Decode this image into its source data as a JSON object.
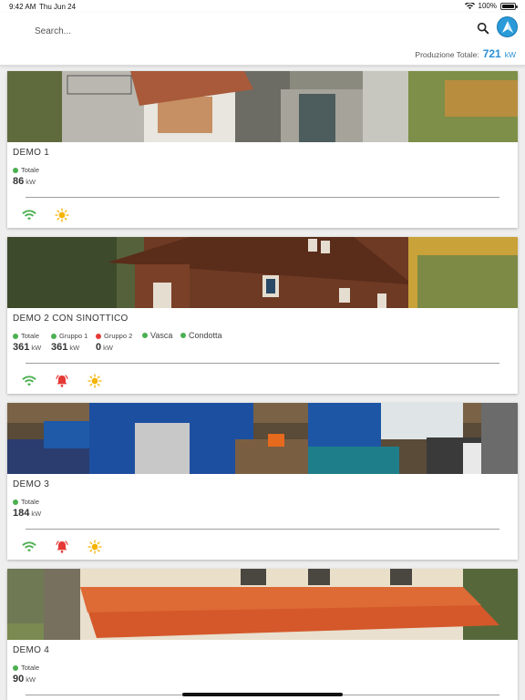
{
  "status_bar": {
    "time": "9:42 AM",
    "date": "Thu Jun 24",
    "battery": "100%"
  },
  "header": {
    "search_placeholder": "Search...",
    "total_label": "Produzione Totale:",
    "total_value": "721",
    "total_unit": "kW"
  },
  "plants": [
    {
      "name": "DEMO 1",
      "metrics": [
        {
          "label": "Totale",
          "status": "green",
          "value": "86",
          "unit": "kW"
        }
      ],
      "icons": [
        "wifi-icon",
        "sun-icon"
      ]
    },
    {
      "name": "DEMO 2 CON SINOTTICO",
      "metrics": [
        {
          "label": "Totale",
          "status": "green",
          "value": "361",
          "unit": "kW"
        },
        {
          "label": "Gruppo 1",
          "status": "green",
          "value": "361",
          "unit": "kW"
        },
        {
          "label": "Gruppo 2",
          "status": "red",
          "value": "0",
          "unit": "kW"
        }
      ],
      "flags": [
        {
          "label": "Vasca",
          "status": "green"
        },
        {
          "label": "Condotta",
          "status": "green"
        }
      ],
      "icons": [
        "wifi-icon",
        "alarm-bell-icon",
        "sun-icon"
      ]
    },
    {
      "name": "DEMO 3",
      "metrics": [
        {
          "label": "Totale",
          "status": "green",
          "value": "184",
          "unit": "kW"
        }
      ],
      "icons": [
        "wifi-icon",
        "alarm-bell-icon",
        "sun-icon"
      ]
    },
    {
      "name": "DEMO 4",
      "metrics": [
        {
          "label": "Totale",
          "status": "green",
          "value": "90",
          "unit": "kW"
        }
      ],
      "icons": []
    }
  ],
  "colors": {
    "accent": "#2a8fd6",
    "ok": "#4caf50",
    "alarm": "#e53935",
    "sun": "#f5b400"
  }
}
